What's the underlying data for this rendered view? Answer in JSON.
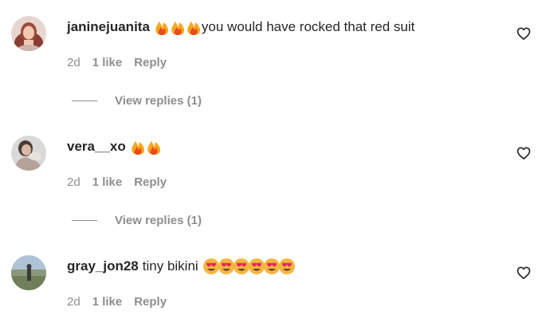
{
  "comments": [
    {
      "username": "janinejuanita",
      "text": "you would have rocked that red suit",
      "emoji": "fire-emoji",
      "emoji_count": 3,
      "time": "2d",
      "likes": "1 like",
      "reply_label": "Reply",
      "view_replies": "View replies (1)"
    },
    {
      "username": "vera__xo",
      "text": "",
      "emoji": "fire-emoji",
      "emoji_count": 2,
      "time": "2d",
      "likes": "1 like",
      "reply_label": "Reply",
      "view_replies": "View replies (1)"
    },
    {
      "username": "gray_jon28",
      "text": "tiny bikini",
      "emoji": "heart-eyes-emoji",
      "emoji_count": 6,
      "time": "2d",
      "likes": "1 like",
      "reply_label": "Reply"
    }
  ],
  "colors": {
    "text": "#262626",
    "secondary": "#8e8e8e",
    "background": "#ffffff"
  }
}
